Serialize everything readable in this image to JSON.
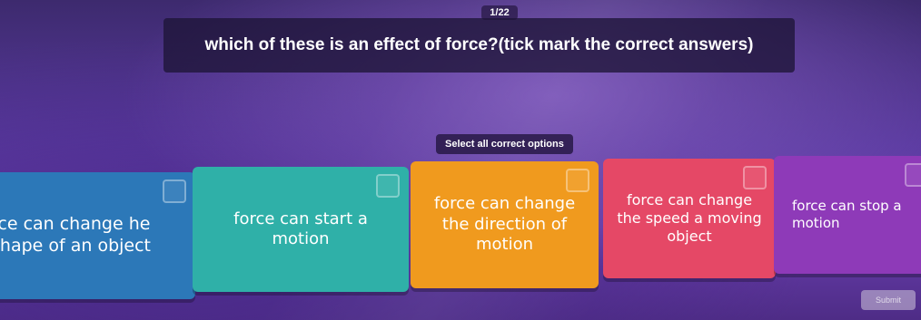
{
  "quiz": {
    "counter": "1/22",
    "question": "which of these is an effect of force?(tick mark the correct answers)",
    "instruction": "Select all correct options",
    "options": [
      {
        "label": "rce can change he shape of an object",
        "color": "#2c78b8"
      },
      {
        "label": "force can start a motion",
        "color": "#2fb0a8"
      },
      {
        "label": "force can change the direction of motion",
        "color": "#f09a1e"
      },
      {
        "label": "force can change the speed a moving object",
        "color": "#e54866"
      },
      {
        "label": "force can stop a motion",
        "color": "#8e3ab8"
      }
    ],
    "submit_label": "Submit"
  }
}
